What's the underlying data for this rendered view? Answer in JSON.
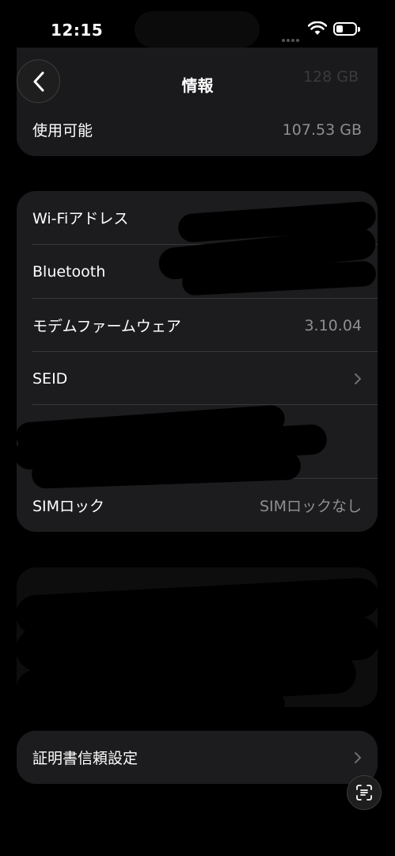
{
  "status_bar": {
    "time": "12:15"
  },
  "nav": {
    "title": "情報",
    "ghost_value": "128 GB"
  },
  "storage": {
    "available_label": "使用可能",
    "available_value": "107.53 GB"
  },
  "network": {
    "wifi_label": "Wi-Fiアドレス",
    "bluetooth_label": "Bluetooth",
    "modem_label": "モデムファームウェア",
    "modem_value": "3.10.04",
    "seid_label": "SEID",
    "sim_label": "SIMロック",
    "sim_value": "SIMロックなし"
  },
  "cert": {
    "label": "証明書信頼設定"
  },
  "icons": {
    "back": "chevron-left-icon",
    "chevron": "chevron-right-icon",
    "wifi": "wifi-icon",
    "battery": "battery-icon",
    "scan": "text-scan-icon"
  },
  "colors": {
    "background": "#000000",
    "card": "#1c1c1e",
    "secondary_text": "#8e8e93",
    "separator": "#38383a"
  }
}
